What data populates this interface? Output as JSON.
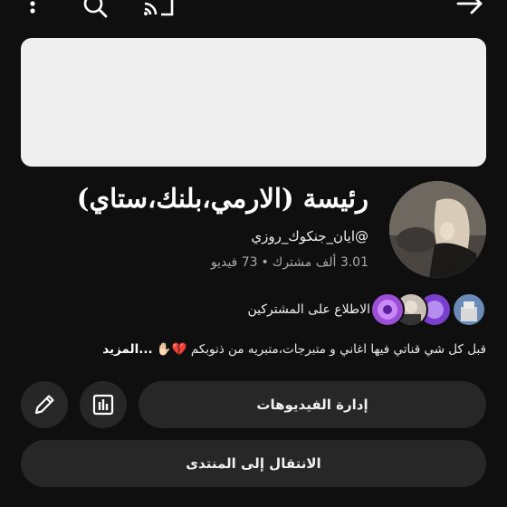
{
  "header": {
    "icons": [
      "more-vert-icon",
      "search-icon",
      "cast-icon",
      "forward-arrow-icon"
    ]
  },
  "channel": {
    "title": "رئيسة (الارمي،بلنك،ستاي)",
    "handle": "@ايان_جنكوك_روزي",
    "subscribers": "3.01 ألف مشترك",
    "separator": "•",
    "videos": "73 فيديو"
  },
  "subscribers_preview": {
    "label": "الاطلاع على المشتركين",
    "avatar_colors": [
      "#6a8ab7",
      "#7b3fd0",
      "#c9bfb6",
      "#9b4fd6"
    ]
  },
  "description": {
    "text": "قبل كل شي قناتي فيها اغاني و متبرجات،متبريه من ذنوبكم 💔✋🏻",
    "more": "...المزيد"
  },
  "actions": {
    "manage_videos": "إدارة الفيديوهات",
    "go_to_community": "الانتقال إلى المنتدى"
  },
  "colors": {
    "background": "#0f0f0f",
    "button": "#272727",
    "secondary_text": "#aaaaaa"
  }
}
